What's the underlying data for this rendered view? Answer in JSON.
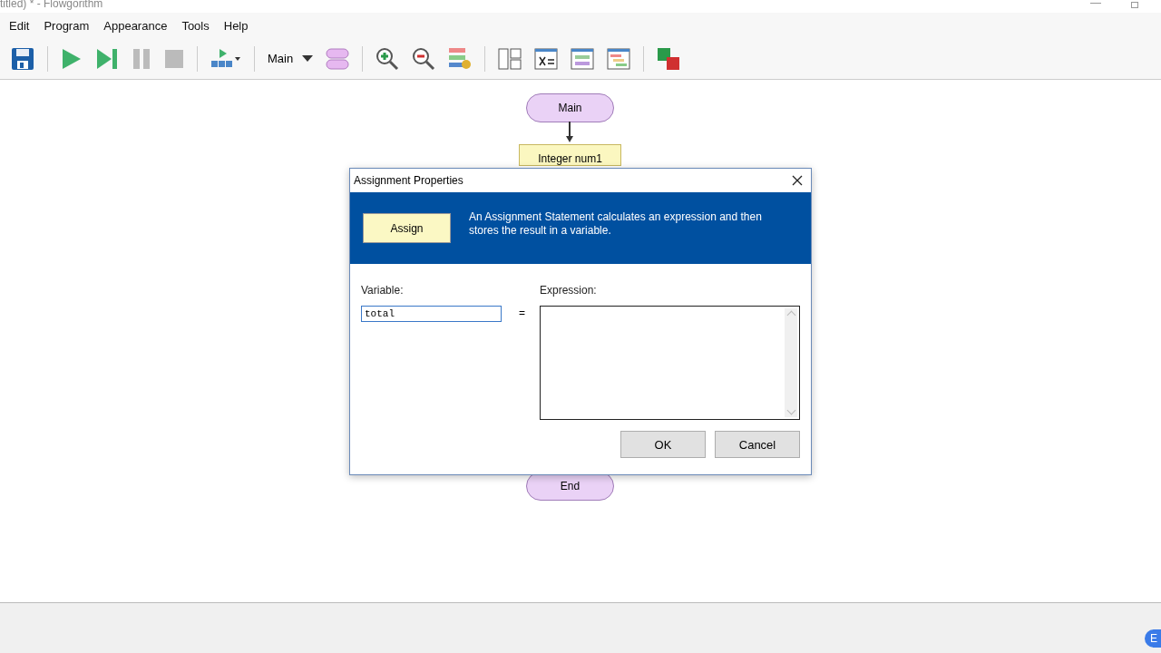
{
  "window": {
    "title": "titled) * - Flowgorithm"
  },
  "menu": [
    "Edit",
    "Program",
    "Appearance",
    "Tools",
    "Help"
  ],
  "toolbar": {
    "function_selector": "Main"
  },
  "flowchart": [
    {
      "kind": "terminal",
      "label": "Main"
    },
    {
      "kind": "declare",
      "label": "Integer num1"
    },
    {
      "kind": "terminal",
      "label": "End"
    }
  ],
  "dialog": {
    "title": "Assignment Properties",
    "shape_label": "Assign",
    "description": "An Assignment Statement calculates an expression and then stores the result in a variable.",
    "variable_label": "Variable:",
    "variable_value": "total",
    "equals": "=",
    "expression_label": "Expression:",
    "buttons": [
      "OK",
      "Cancel"
    ]
  },
  "taskbar": {
    "language": "E"
  }
}
